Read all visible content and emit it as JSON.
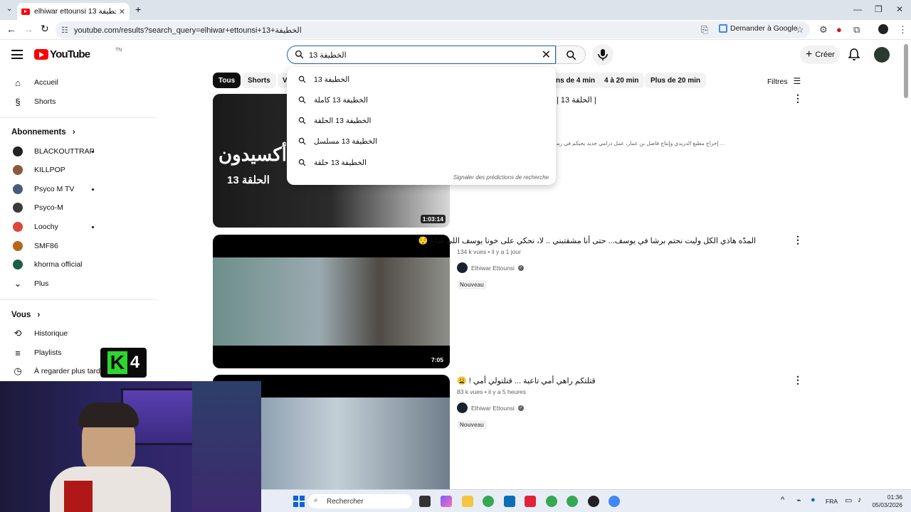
{
  "browser": {
    "tab_title": "elhiwar ettounsi 13 الخطيفة - Yo",
    "url": "youtube.com/results?search_query=elhiwar+ettounsi+13+الخطيفة",
    "ask_google": "Demander à Google",
    "icons": [
      "tab-list-icon",
      "new-tab-icon",
      "back-icon",
      "forward-icon",
      "reload-icon",
      "site-settings-icon",
      "install-icon",
      "bookmark-star-icon",
      "extensions-icon",
      "profile-icon",
      "menu-icon"
    ]
  },
  "header": {
    "logo": "YouTube",
    "country_code": "TN",
    "search_value": "الخطيفة 13",
    "create_label": "Créer"
  },
  "search_suggestions": {
    "items": [
      "الخطيفة 13",
      "الخطيفة 13 كاملة",
      "الخطيفة 13 الحلقة",
      "الخطيفة 13 مسلسل",
      "الخطيفة 13 حلقة"
    ],
    "report": "Signaler des prédictions de recherche"
  },
  "sidebar": {
    "main": [
      {
        "label": "Accueil",
        "icon": "home-icon"
      },
      {
        "label": "Shorts",
        "icon": "shorts-icon"
      }
    ],
    "subscriptions_heading": "Abonnements",
    "subscriptions": [
      {
        "label": "BLACKOUTTRAP",
        "new": true,
        "color": "#222222"
      },
      {
        "label": "KILLPOP",
        "new": false,
        "color": "#8a5a3c"
      },
      {
        "label": "Psyco M TV",
        "new": true,
        "color": "#4a5a7a"
      },
      {
        "label": "Psyco-M",
        "new": false,
        "color": "#3a3a3a"
      },
      {
        "label": "Loochy",
        "new": true,
        "color": "#e0453a"
      },
      {
        "label": "SMF86",
        "new": false,
        "color": "#b5651d"
      },
      {
        "label": "khorma official",
        "new": false,
        "color": "#1f5c4a"
      }
    ],
    "more_label": "Plus",
    "you_heading": "Vous",
    "you_items": [
      {
        "label": "Historique",
        "icon": "history-icon"
      },
      {
        "label": "Playlists",
        "icon": "playlists-icon"
      },
      {
        "label": "À regarder plus tard",
        "icon": "watch-later-icon"
      }
    ]
  },
  "chips": {
    "visible_left": [
      "Tous",
      "Shorts",
      "V"
    ],
    "visible_right": [
      "ns de 4 min",
      "4 à 20 min",
      "Plus de 20 min"
    ],
    "filters_label": "Filtres"
  },
  "results": [
    {
      "title_fragment": "| الحلقة 13 |",
      "description": "... إخراج مطبع الدريدي وإنتاج فاضل بن عمار، عمل درامي جديد يجيكم في رمضان 2026",
      "duration": "1:03:14",
      "thumb_text": [
        "أكسيدون",
        "الحلقة 13"
      ]
    },
    {
      "title": "المدّه هاذي الكل وليت نحتم برشا في يوسف... حتى أنا مشقتبني .. لا، نحكي على خونا يوسف اللي ضاع 😌",
      "views": "134 k vues",
      "age": "il y a 1 jour",
      "channel": "Elhiwar Ettounsi",
      "badge": "Nouveau",
      "duration": "7:05"
    },
    {
      "title": "قتلتكم راهي أمي تاعبة ... قتلتولي أمي ! 😩",
      "views": "83 k vues",
      "age": "il y a 5 heures",
      "channel": "Elhiwar Ettounsi",
      "badge": "Nouveau"
    }
  ],
  "overlay": {
    "logo_letter": "K",
    "logo_number": "4"
  },
  "taskbar": {
    "search_placeholder": "Rechercher",
    "lang": "FRA",
    "time": "01:36",
    "date": "05/03/2026"
  }
}
